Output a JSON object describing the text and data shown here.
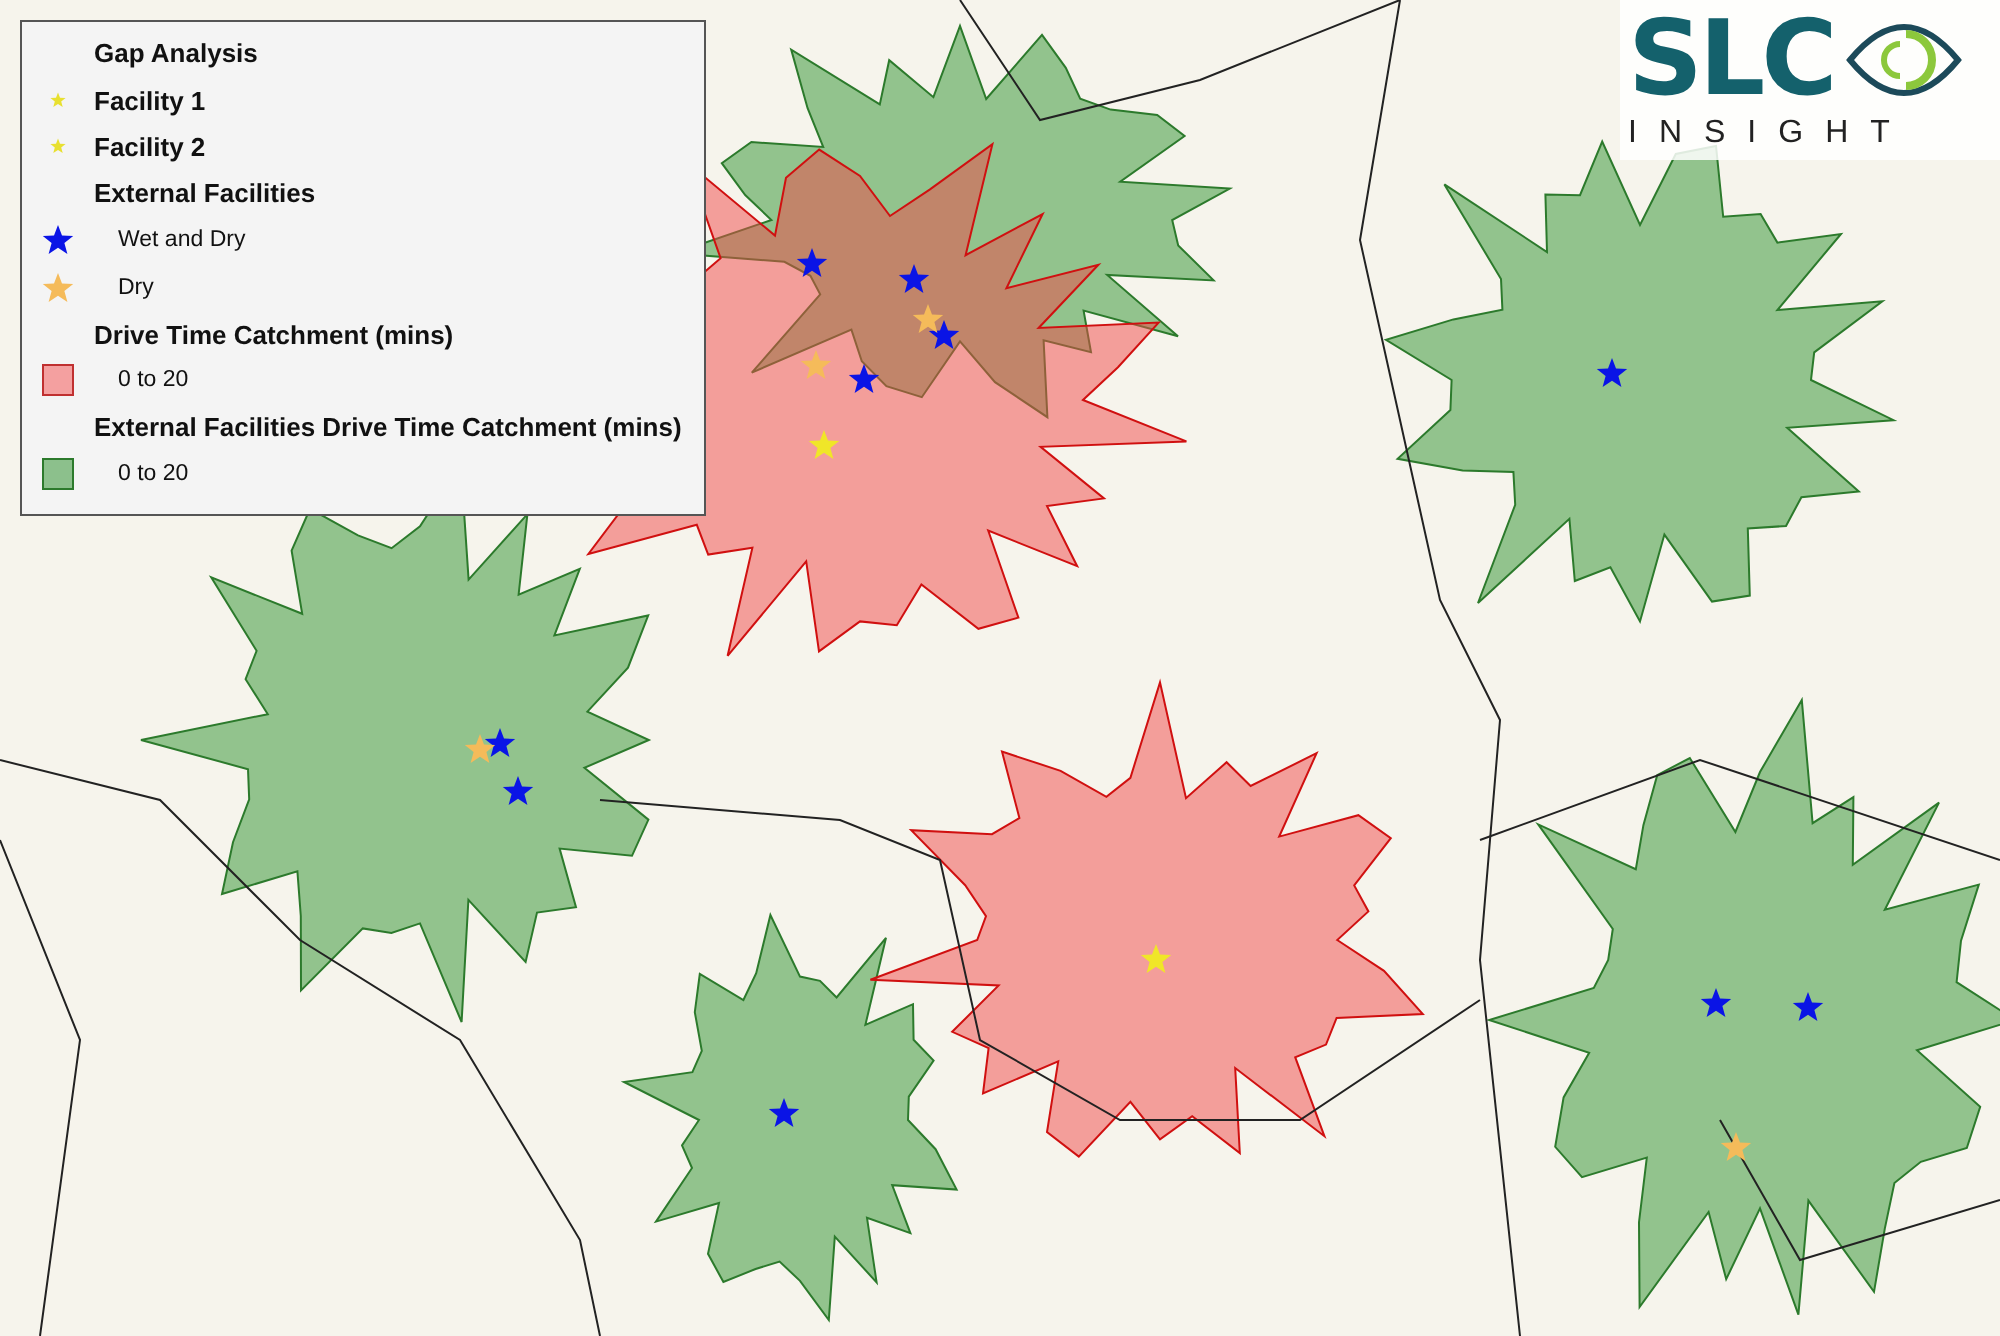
{
  "legend": {
    "title": "Gap Analysis",
    "entries": [
      {
        "kind": "point",
        "label": "Facility 1",
        "color": "#e8e030"
      },
      {
        "kind": "point",
        "label": "Facility 2",
        "color": "#e8e030"
      },
      {
        "kind": "heading",
        "label": "External Facilities"
      },
      {
        "kind": "star",
        "label": "Wet and Dry",
        "color": "#0a14e6"
      },
      {
        "kind": "star",
        "label": "Dry",
        "color": "#f5bb5a"
      },
      {
        "kind": "heading",
        "label": "Drive Time Catchment (mins)"
      },
      {
        "kind": "swatch",
        "label": "0 to 20",
        "color": "#f4a0a0"
      },
      {
        "kind": "heading",
        "label": "External Facilities Drive Time Catchment (mins)"
      },
      {
        "kind": "swatch",
        "label": "0 to 20",
        "color": "#8cc08c"
      }
    ]
  },
  "logo": {
    "wordmark": "SLC",
    "tagline": "INSIGHT"
  }
}
